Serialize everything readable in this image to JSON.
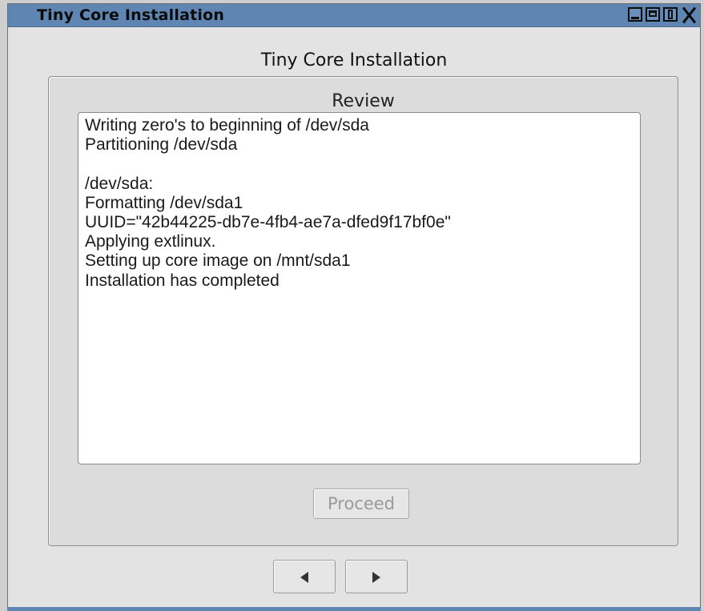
{
  "window": {
    "title": "Tiny Core Installation",
    "controls": [
      "minimize-icon",
      "maximize-icon",
      "shade-icon",
      "close-icon"
    ],
    "accent_color": "#5f86b3"
  },
  "app": {
    "heading": "Tiny Core Installation"
  },
  "review": {
    "title": "Review",
    "log_lines": [
      "Writing zero's to beginning of /dev/sda",
      "Partitioning /dev/sda",
      "",
      "/dev/sda:",
      "Formatting /dev/sda1",
      "UUID=\"42b44225-db7e-4fb4-ae7a-dfed9f17bf0e\"",
      "Applying extlinux.",
      "Setting up core image on /mnt/sda1",
      "Installation has completed"
    ],
    "proceed_label": "Proceed",
    "proceed_enabled": false
  },
  "navigation": {
    "back_icon": "left-triangle-icon",
    "next_icon": "right-triangle-icon"
  }
}
